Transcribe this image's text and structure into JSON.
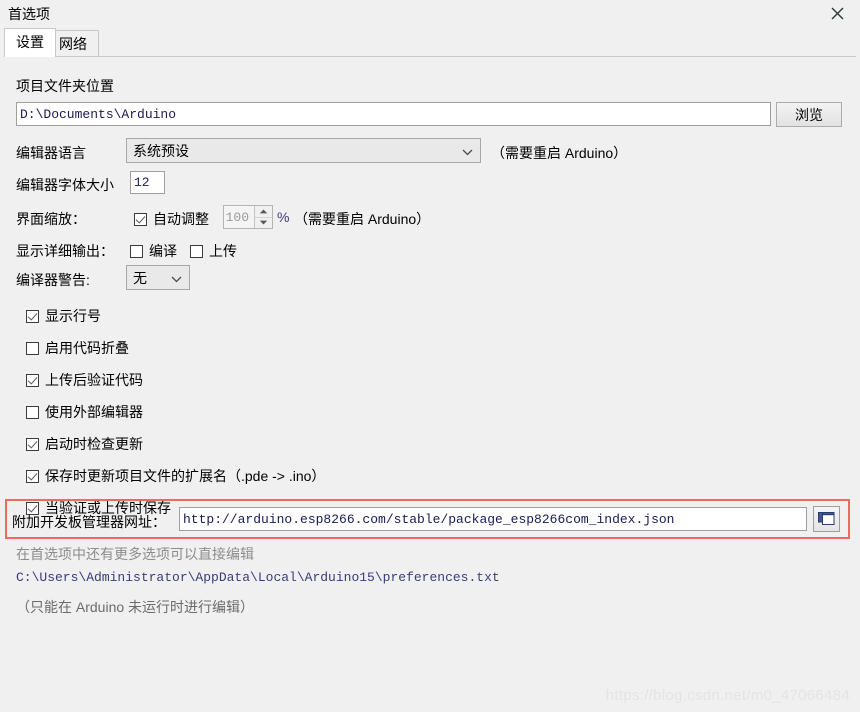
{
  "window": {
    "title": "首选项",
    "close_icon": "close-icon"
  },
  "tabs": [
    {
      "label": "设置",
      "active": true
    },
    {
      "label": "网络",
      "active": false
    }
  ],
  "sketchbook": {
    "label": "项目文件夹位置",
    "path_value": "D:\\Documents\\Arduino",
    "browse_label": "浏览"
  },
  "language": {
    "label": "编辑器语言",
    "selected": "系统预设",
    "options": [
      "系统预设"
    ],
    "hint": "（需要重启 Arduino）",
    "caret_icon": "chevron-down-icon"
  },
  "font_size": {
    "label": "编辑器字体大小",
    "value": "12"
  },
  "scale": {
    "label": "界面缩放：",
    "auto_label": "自动调整",
    "auto_checked": true,
    "value": "100",
    "unit": "%",
    "hint": "（需要重启 Arduino）",
    "up_icon": "spinner-up-icon",
    "down_icon": "spinner-down-icon"
  },
  "verbose": {
    "label": "显示详细输出：",
    "compile_label": "编译",
    "compile_checked": false,
    "upload_label": "上传",
    "upload_checked": false
  },
  "warnings": {
    "label": "编译器警告:",
    "selected": "无",
    "options": [
      "无"
    ],
    "caret_icon": "chevron-down-icon"
  },
  "options": [
    {
      "label": "显示行号",
      "checked": true
    },
    {
      "label": "启用代码折叠",
      "checked": false
    },
    {
      "label": "上传后验证代码",
      "checked": true
    },
    {
      "label": "使用外部编辑器",
      "checked": false
    },
    {
      "label": "启动时检查更新",
      "checked": true
    },
    {
      "label": "保存时更新项目文件的扩展名（.pde -> .ino）",
      "checked": true
    },
    {
      "label": "当验证或上传时保存",
      "checked": true
    }
  ],
  "board_urls": {
    "label": "附加开发板管理器网址：",
    "value": "http://arduino.esp8266.com/stable/package_esp8266com_index.json",
    "button_icon": "open-windows-icon",
    "highlight_color": "#ed6a62"
  },
  "footer": {
    "more_prefs": "在首选项中还有更多选项可以直接编辑",
    "prefs_path": "C:\\Users\\Administrator\\AppData\\Local\\Arduino15\\preferences.txt",
    "edit_note": "（只能在 Arduino 未运行时进行编辑）"
  },
  "watermark": "https://blog.csdn.net/m0_47066484"
}
